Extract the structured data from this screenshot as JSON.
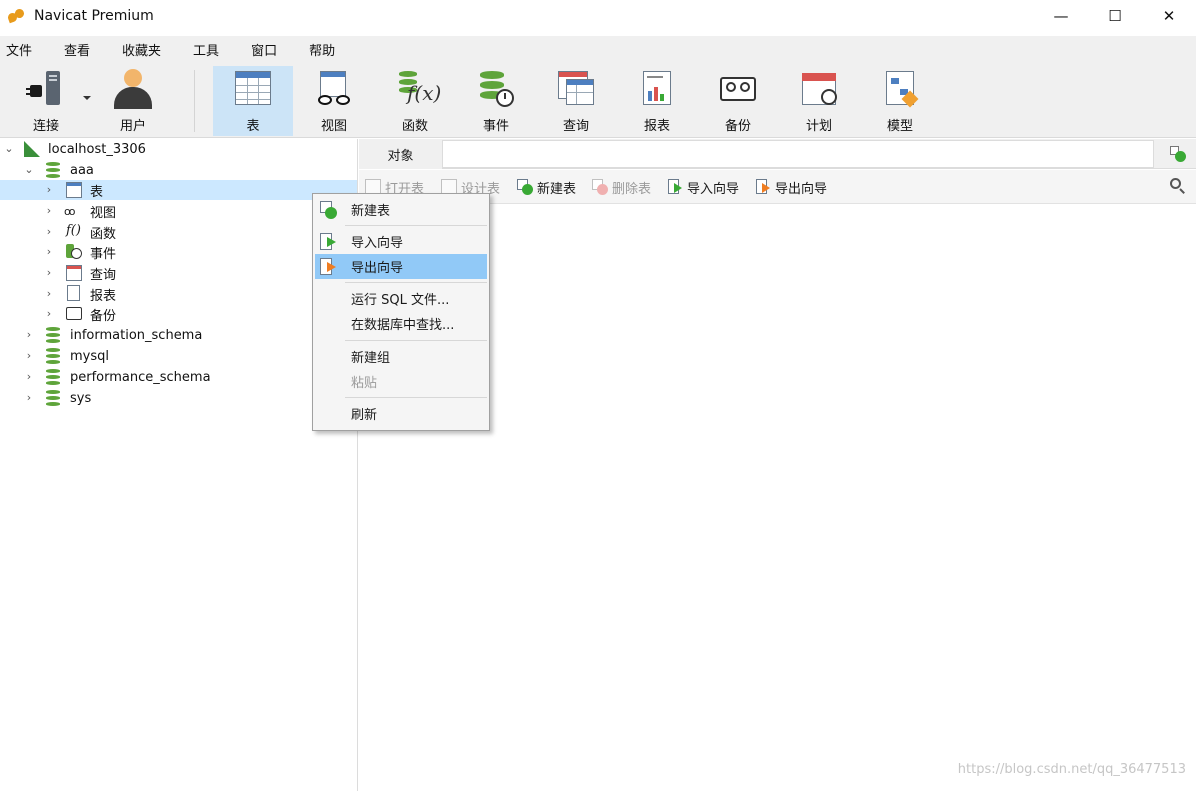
{
  "window": {
    "title": "Navicat Premium",
    "controls": {
      "minimize": "—",
      "maximize": "☐",
      "close": "✕"
    }
  },
  "menu": [
    "文件",
    "查看",
    "收藏夹",
    "工具",
    "窗口",
    "帮助"
  ],
  "toolbar": {
    "items": [
      {
        "label": "连接",
        "icon": "connection-icon"
      },
      {
        "label": "用户",
        "icon": "user-icon"
      },
      {
        "label": "表",
        "icon": "table-icon",
        "active": true
      },
      {
        "label": "视图",
        "icon": "view-icon"
      },
      {
        "label": "函数",
        "icon": "function-icon"
      },
      {
        "label": "事件",
        "icon": "event-icon"
      },
      {
        "label": "查询",
        "icon": "query-icon"
      },
      {
        "label": "报表",
        "icon": "report-icon"
      },
      {
        "label": "备份",
        "icon": "backup-icon"
      },
      {
        "label": "计划",
        "icon": "schedule-icon"
      },
      {
        "label": "模型",
        "icon": "model-icon"
      }
    ]
  },
  "tree": {
    "connection": "localhost_3306",
    "database": "aaa",
    "db_children": [
      "表",
      "视图",
      "函数",
      "事件",
      "查询",
      "报表",
      "备份"
    ],
    "other_databases": [
      "information_schema",
      "mysql",
      "performance_schema",
      "sys"
    ]
  },
  "object_panel": {
    "tab": "对象",
    "buttons": [
      {
        "label": "打开表",
        "disabled": true
      },
      {
        "label": "设计表",
        "disabled": true
      },
      {
        "label": "新建表",
        "disabled": false
      },
      {
        "label": "删除表",
        "disabled": true
      },
      {
        "label": "导入向导",
        "disabled": false
      },
      {
        "label": "导出向导",
        "disabled": false
      }
    ]
  },
  "context_menu": {
    "items": [
      {
        "label": "新建表",
        "icon": "new-table-icon"
      },
      {
        "label": "导入向导",
        "icon": "import-wizard-icon"
      },
      {
        "label": "导出向导",
        "icon": "export-wizard-icon",
        "highlighted": true
      },
      {
        "label": "运行 SQL 文件..."
      },
      {
        "label": "在数据库中查找..."
      },
      {
        "label": "新建组"
      },
      {
        "label": "粘贴",
        "disabled": true
      },
      {
        "label": "刷新"
      }
    ]
  },
  "watermark": "https://blog.csdn.net/qq_36477513",
  "colors": {
    "accent_selected": "#cce4f7",
    "menu_highlight": "#91c9f7",
    "db_green": "#5ea43a"
  }
}
